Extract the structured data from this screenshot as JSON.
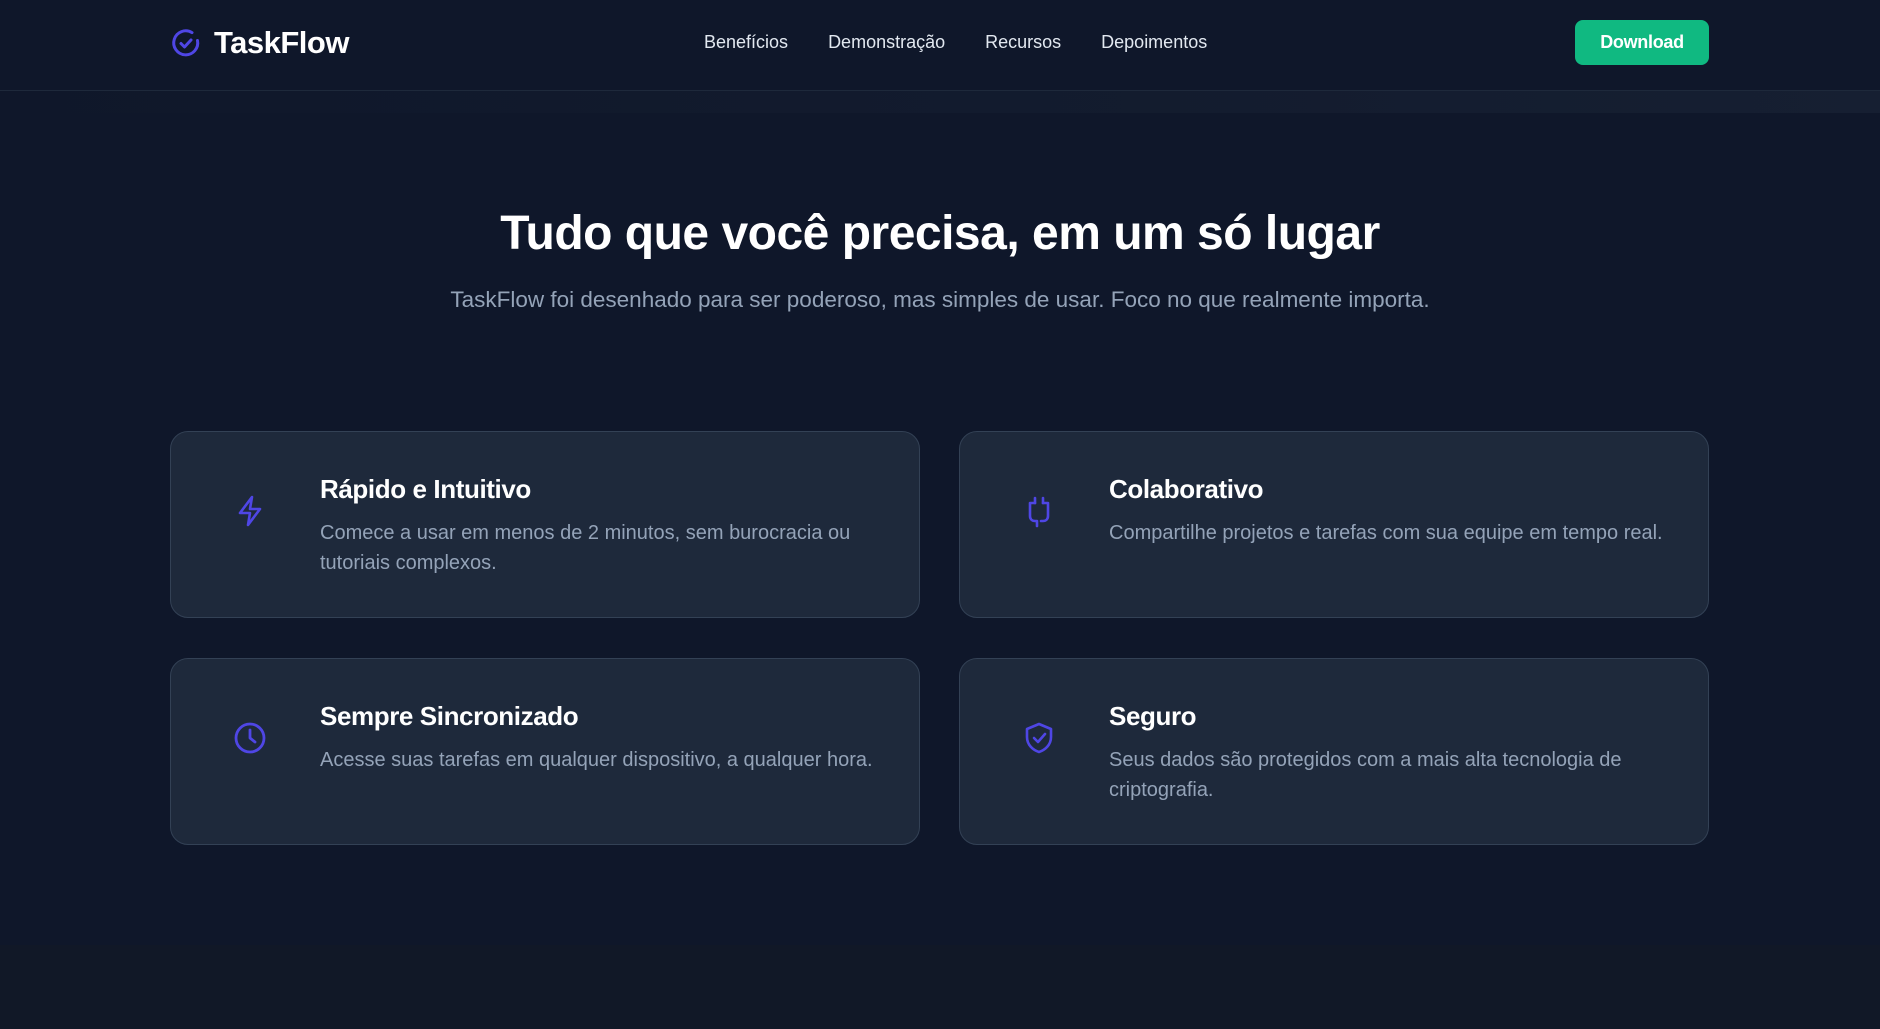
{
  "brand": {
    "name": "TaskFlow",
    "icon": "check-circle-icon",
    "accent_color": "#4f46e5"
  },
  "nav": {
    "links": [
      {
        "label": "Benefícios"
      },
      {
        "label": "Demonstração"
      },
      {
        "label": "Recursos"
      },
      {
        "label": "Depoimentos"
      }
    ],
    "download_label": "Download",
    "download_color": "#10b981"
  },
  "section": {
    "title": "Tudo que você precisa, em um só lugar",
    "subtitle": "TaskFlow foi desenhado para ser poderoso, mas simples de usar. Foco no que realmente importa."
  },
  "features": [
    {
      "icon": "lightning-bolt-icon",
      "title": "Rápido e Intuitivo",
      "description": "Comece a usar em menos de 2 minutos, sem burocracia ou tutoriais complexos."
    },
    {
      "icon": "plug-icon",
      "title": "Colaborativo",
      "description": "Compartilhe projetos e tarefas com sua equipe em tempo real."
    },
    {
      "icon": "clock-icon",
      "title": "Sempre Sincronizado",
      "description": "Acesse suas tarefas em qualquer dispositivo, a qualquer hora."
    },
    {
      "icon": "shield-check-icon",
      "title": "Seguro",
      "description": "Seus dados são protegidos com a mais alta tecnologia de criptografia."
    }
  ],
  "colors": {
    "background": "#0f172a",
    "card_background": "#1e293b",
    "text_muted": "#94a3b8"
  }
}
